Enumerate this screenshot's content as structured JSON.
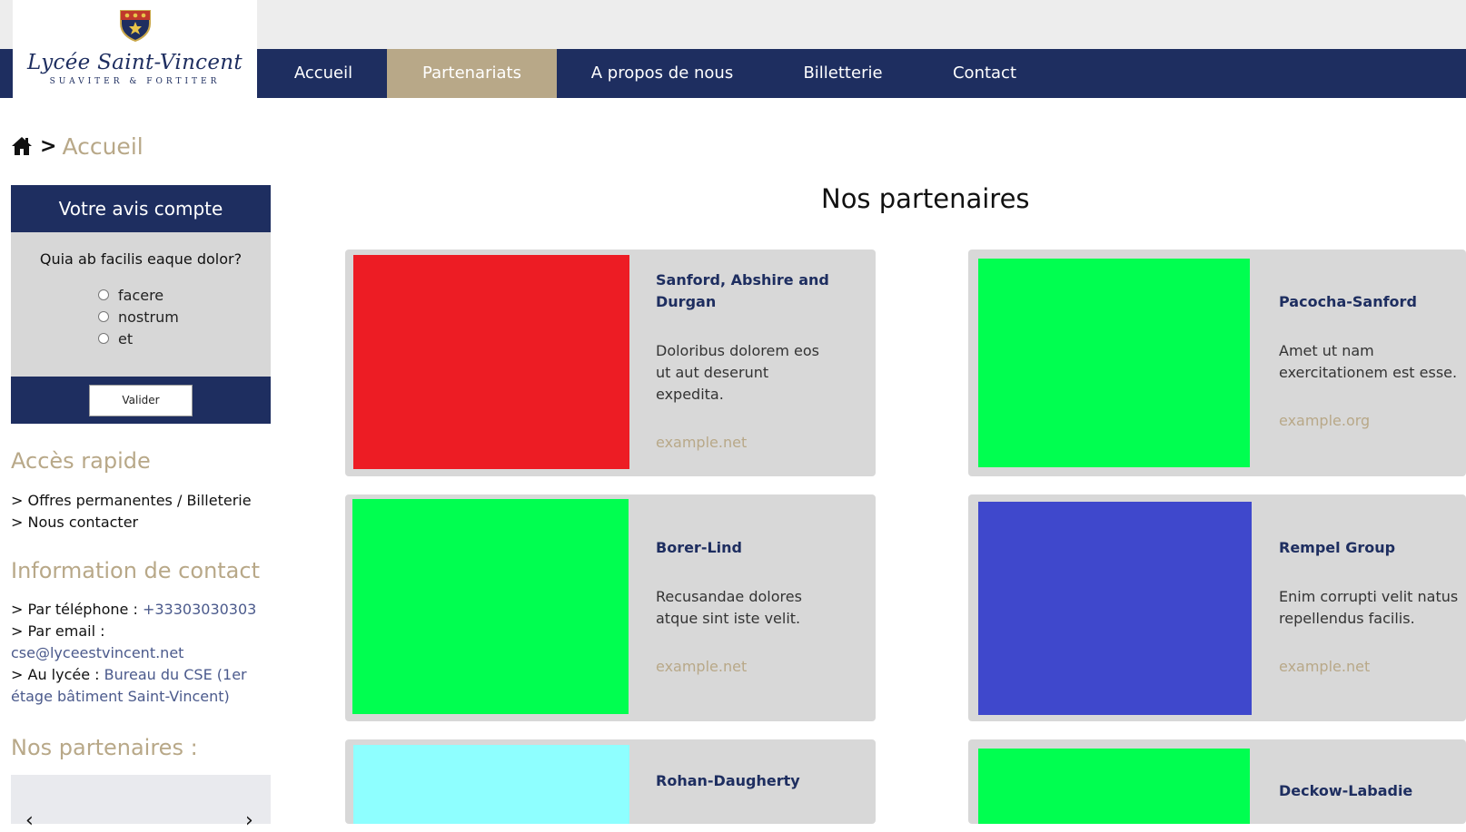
{
  "header": {
    "logo": {
      "title": "Lycée Saint-Vincent",
      "motto": "SUAVITER & FORTITER"
    },
    "nav": [
      {
        "label": "Accueil",
        "active": false
      },
      {
        "label": "Partenariats",
        "active": true
      },
      {
        "label": "A propos de nous",
        "active": false
      },
      {
        "label": "Billetterie",
        "active": false
      },
      {
        "label": "Contact",
        "active": false
      }
    ]
  },
  "breadcrumb": {
    "separator": ">",
    "current": "Accueil"
  },
  "poll": {
    "title": "Votre avis compte",
    "question": "Quia ab facilis eaque dolor?",
    "options": [
      "facere",
      "nostrum",
      "et"
    ],
    "submit_label": "Valider"
  },
  "quick_access": {
    "title": "Accès rapide",
    "links": [
      {
        "prefix": ">",
        "label": "Offres permanentes / Billeterie"
      },
      {
        "prefix": ">",
        "label": "Nous contacter"
      }
    ]
  },
  "contact_info": {
    "title": "Information de contact",
    "phone_label": "Par téléphone :",
    "phone_value": "+33303030303",
    "email_label": "Par email :",
    "email_value": "cse@lyceestvincent.net",
    "location_label": "Au lycée :",
    "location_value_line1": "Bureau du CSE (1er",
    "location_value_line2": "étage bâtiment Saint-Vincent)"
  },
  "sidebar_partners": {
    "title": "Nos partenaires :",
    "prev_symbol": "‹",
    "next_symbol": "›"
  },
  "main": {
    "title": "Nos partenaires",
    "partners": [
      {
        "name": "Sanford, Abshire and Durgan",
        "description": "Doloribus dolorem eos ut aut deserunt expedita.",
        "link": "example.net",
        "image_color": "#ed1c24"
      },
      {
        "name": "Pacocha-Sanford",
        "description": "Amet ut nam exercitationem est esse.",
        "link": "example.org",
        "image_color": "#00ff50"
      },
      {
        "name": "Borer-Lind",
        "description": "Recusandae dolores atque sint iste velit.",
        "link": "example.net",
        "image_color": "#00ff50"
      },
      {
        "name": "Rempel Group",
        "description": "Enim corrupti velit natus repellendus facilis.",
        "link": "example.net",
        "image_color": "#3f48cc"
      },
      {
        "name": "Rohan-Daugherty",
        "description": "",
        "link": "",
        "image_color": "#8effff"
      },
      {
        "name": "Deckow-Labadie",
        "description": "",
        "link": "",
        "image_color": "#00ff50"
      }
    ]
  },
  "colors": {
    "navy": "#1e2e60",
    "gold": "#b8a888",
    "card_bg": "#d8d8d8"
  }
}
